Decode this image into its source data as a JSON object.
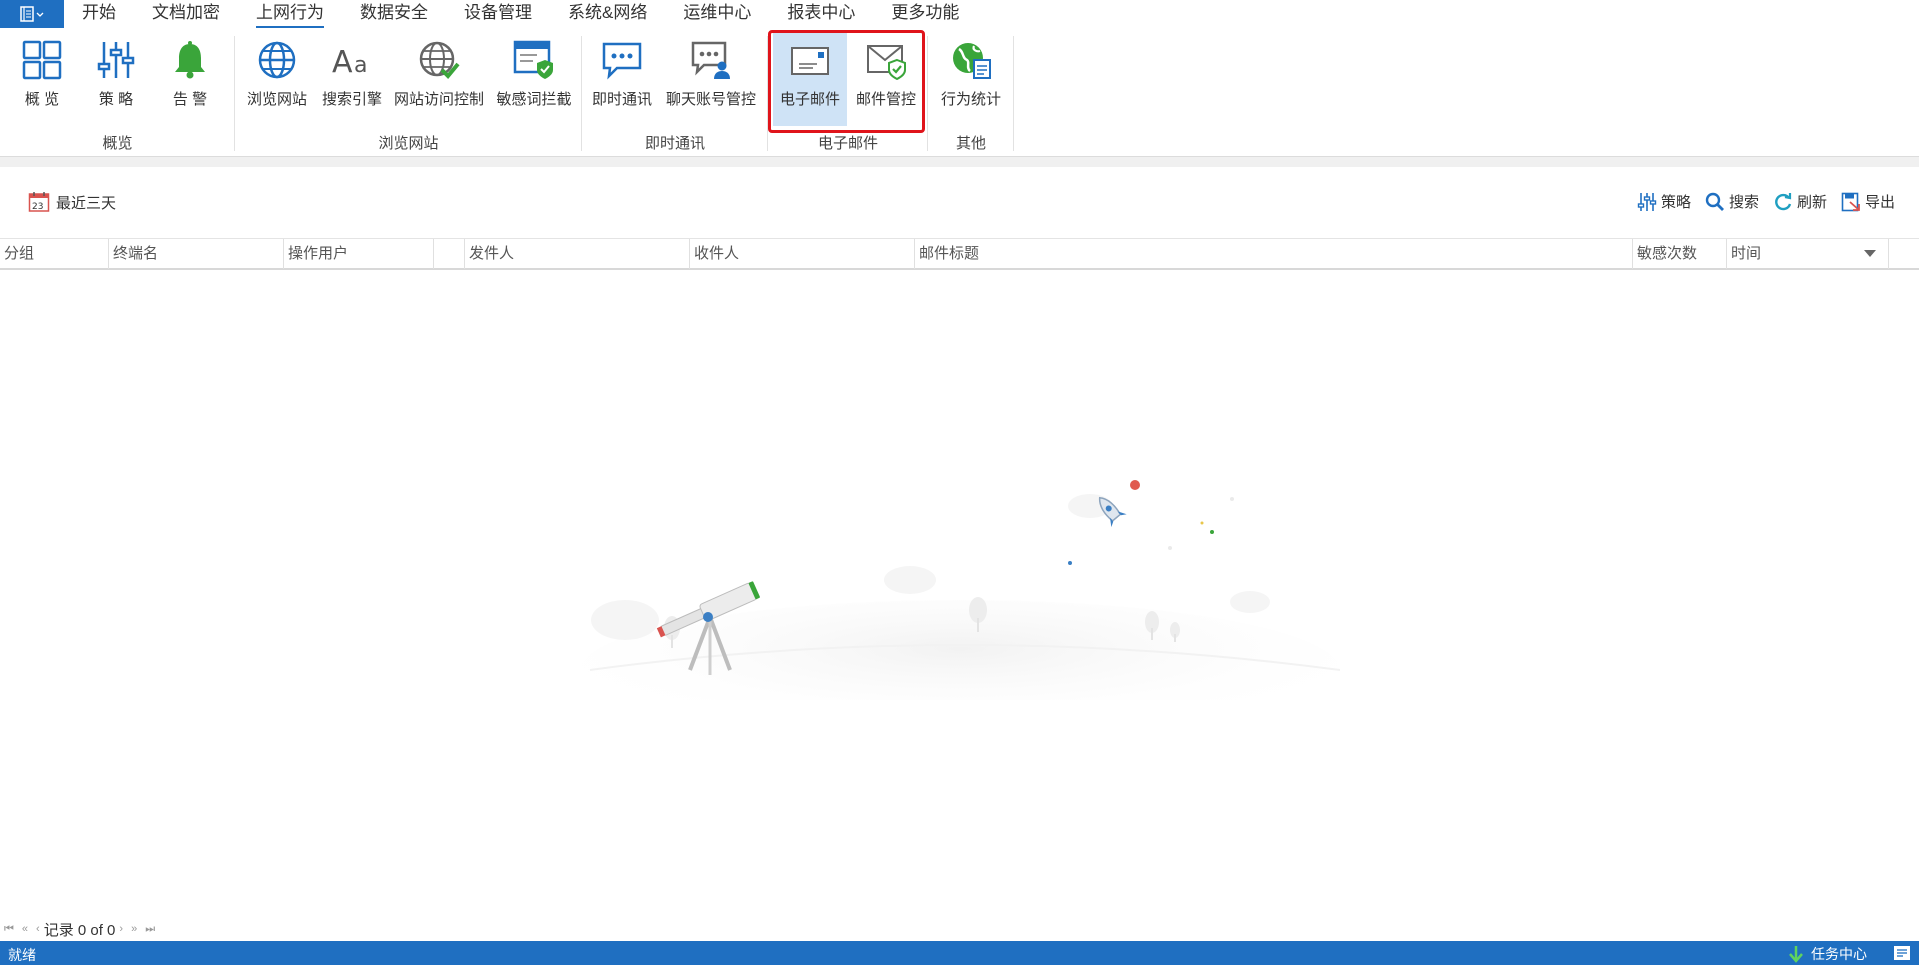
{
  "menu": {
    "tabs": [
      {
        "label": "开始"
      },
      {
        "label": "文档加密"
      },
      {
        "label": "上网行为"
      },
      {
        "label": "数据安全"
      },
      {
        "label": "设备管理"
      },
      {
        "label": "系统&网络"
      },
      {
        "label": "运维中心"
      },
      {
        "label": "报表中心"
      },
      {
        "label": "更多功能"
      }
    ],
    "active": "上网行为"
  },
  "ribbon": {
    "groups": [
      {
        "label": "概览",
        "buttons": [
          {
            "label": "概 览"
          },
          {
            "label": "策 略"
          },
          {
            "label": "告 警"
          }
        ]
      },
      {
        "label": "浏览网站",
        "buttons": [
          {
            "label": "浏览网站"
          },
          {
            "label": "搜索引擎"
          },
          {
            "label": "网站访问控制"
          },
          {
            "label": "敏感词拦截"
          }
        ]
      },
      {
        "label": "即时通讯",
        "buttons": [
          {
            "label": "即时通讯"
          },
          {
            "label": "聊天账号管控"
          }
        ]
      },
      {
        "label": "电子邮件",
        "buttons": [
          {
            "label": "电子邮件"
          },
          {
            "label": "邮件管控"
          }
        ]
      },
      {
        "label": "其他",
        "buttons": [
          {
            "label": "行为统计"
          }
        ]
      }
    ],
    "selected": "电子邮件",
    "highlight_color": "#e0141b",
    "icon_colors": {
      "blue": "#1f6fc1",
      "green": "#3aa53a"
    }
  },
  "toolbar": {
    "date_filter": "最近三天",
    "calendar_day": "23",
    "actions": [
      {
        "label": "策略",
        "icon": "sliders-icon"
      },
      {
        "label": "搜索",
        "icon": "search-icon"
      },
      {
        "label": "刷新",
        "icon": "refresh-icon"
      },
      {
        "label": "导出",
        "icon": "export-icon"
      }
    ]
  },
  "grid": {
    "columns": [
      "分组",
      "终端名",
      "操作用户",
      "",
      "发件人",
      "收件人",
      "邮件标题",
      "敏感次数",
      "时间"
    ],
    "rows": []
  },
  "pager": {
    "record_text": "记录 0 of 0"
  },
  "status": {
    "text": "就绪",
    "task_center": "任务中心",
    "bar_color": "#1f6fc1"
  }
}
